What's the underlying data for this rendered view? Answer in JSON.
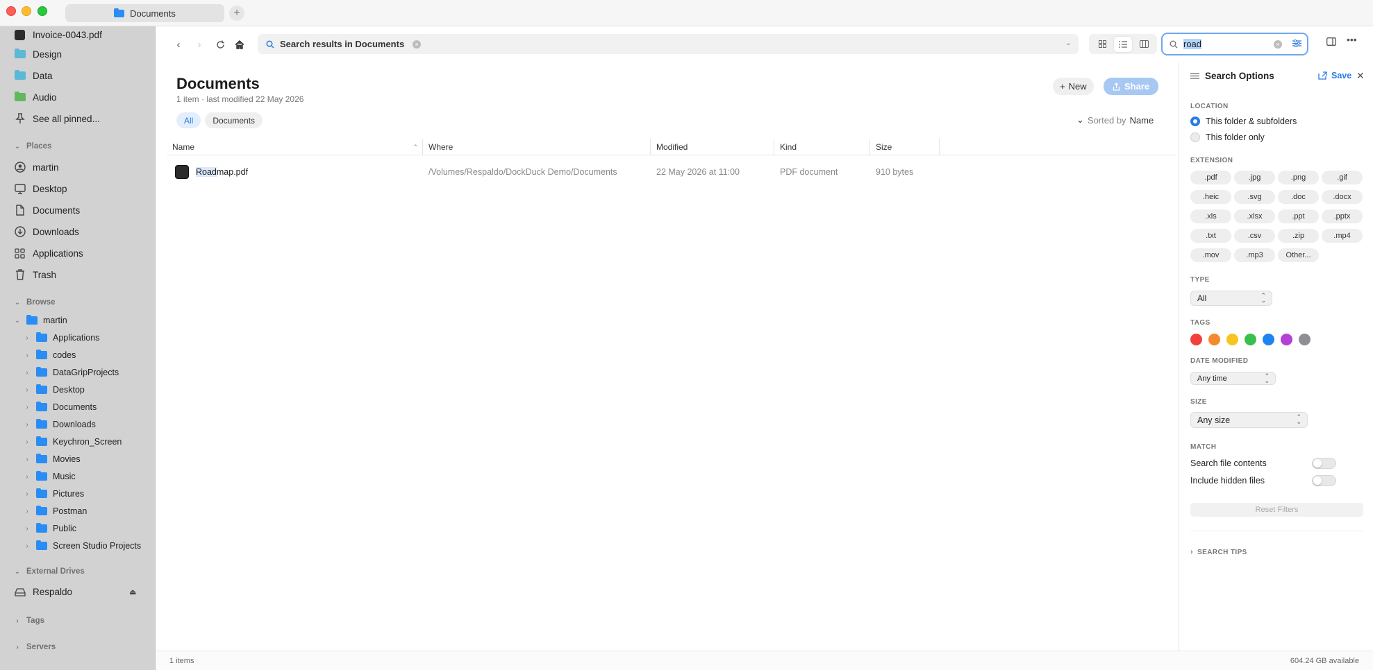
{
  "window": {
    "tab_title": "Documents",
    "new_tab_label": "+"
  },
  "sidebar": {
    "pinned": [
      {
        "label": "Invoice-0043.pdf",
        "icon": "pdf-file-icon"
      },
      {
        "label": "Design",
        "icon": "folder-icon"
      },
      {
        "label": "Data",
        "icon": "folder-icon"
      },
      {
        "label": "Audio",
        "icon": "folder-icon"
      },
      {
        "label": "See all pinned...",
        "icon": "pin-icon"
      }
    ],
    "places_header": "Places",
    "places": [
      {
        "label": "martin",
        "icon": "user-icon"
      },
      {
        "label": "Desktop",
        "icon": "desktop-icon"
      },
      {
        "label": "Documents",
        "icon": "document-icon"
      },
      {
        "label": "Downloads",
        "icon": "download-icon"
      },
      {
        "label": "Applications",
        "icon": "applications-icon"
      },
      {
        "label": "Trash",
        "icon": "trash-icon"
      }
    ],
    "browse_header": "Browse",
    "browse_root": "martin",
    "browse_children": [
      "Applications",
      "codes",
      "DataGripProjects",
      "Desktop",
      "Documents",
      "Downloads",
      "Keychron_Screen",
      "Movies",
      "Music",
      "Pictures",
      "Postman",
      "Public",
      "Screen Studio Projects"
    ],
    "external_header": "External Drives",
    "external_drive": "Respaldo",
    "tags_header": "Tags",
    "servers_header": "Servers"
  },
  "toolbar": {
    "path_label": "Search results in Documents",
    "search_value": "road"
  },
  "main": {
    "title": "Documents",
    "subtitle": "1 item · last modified 22 May 2026",
    "filter_all": "All",
    "filter_documents": "Documents",
    "new_label": "New",
    "share_label": "Share",
    "sorted_by_label": "Sorted by",
    "sorted_by_value": "Name",
    "columns": {
      "name": "Name",
      "where": "Where",
      "modified": "Modified",
      "kind": "Kind",
      "size": "Size"
    },
    "rows": [
      {
        "name_match": "Road",
        "name_rest": "map.pdf",
        "where": "/Volumes/Respaldo/DockDuck Demo/Documents",
        "modified": "22 May 2026 at 11:00",
        "kind": "PDF document",
        "size": "910 bytes"
      }
    ]
  },
  "status": {
    "items": "1 items",
    "available": "604.24 GB available"
  },
  "search_options": {
    "title": "Search Options",
    "save_label": "Save",
    "location_label": "LOCATION",
    "location_options": [
      "This folder & subfolders",
      "This folder only"
    ],
    "location_selected": "This folder & subfolders",
    "extension_label": "EXTENSION",
    "extensions": [
      ".pdf",
      ".jpg",
      ".png",
      ".gif",
      ".heic",
      ".svg",
      ".doc",
      ".docx",
      ".xls",
      ".xlsx",
      ".ppt",
      ".pptx",
      ".txt",
      ".csv",
      ".zip",
      ".mp4",
      ".mov",
      ".mp3",
      "Other..."
    ],
    "type_label": "TYPE",
    "type_value": "All",
    "tags_label": "TAGS",
    "tag_colors": [
      "#f2403b",
      "#f5892e",
      "#f7c51d",
      "#3bbf4c",
      "#1f84f0",
      "#b540d6",
      "#8e8e93"
    ],
    "date_modified_label": "DATE MODIFIED",
    "date_modified_value": "Any time",
    "size_label": "SIZE",
    "size_value": "Any size",
    "match_label": "MATCH",
    "search_contents_label": "Search file contents",
    "include_hidden_label": "Include hidden files",
    "reset_label": "Reset Filters",
    "tips_label": "SEARCH TIPS"
  }
}
